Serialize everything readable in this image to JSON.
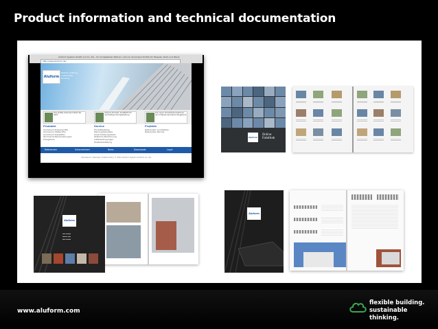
{
  "slide": {
    "title": "Product information and technical documentation"
  },
  "browser": {
    "window_title": "Aluform System GmbH und Co. KG – Ihr kompetenter Partner rund um Aluminium-Profile für Fassade, Dach und Wand",
    "url": "http://www.aluform.de/",
    "site": {
      "logo": "Aluform",
      "slogan": "flexible building. sustainable thinking.",
      "cards": [
        "Das größte Sortiment Stahl der Welt",
        "Aluform-Produkt: ALUMATIC für nachhaltige Dachgestaltung",
        "Die neuen Produktinformationen als umfassendes Nachschlagewerk"
      ],
      "columns": [
        {
          "heading": "Produkte",
          "items": [
            "Aluminium-Trapezprofile",
            "Aluminium-Wellprofile",
            "Aluminium-Kassetten",
            "Technische Beschreibungen",
            "Fotogalerie"
          ]
        },
        {
          "heading": "Service",
          "items": [
            "Produktkatalog",
            "Planungsbeispiele",
            "Ausschreibungstexte",
            "Statische Berechnung",
            "Lieferbedingungen",
            "Musterbestellung"
          ]
        },
        {
          "heading": "Projekte",
          "items": [
            "Referenzen Architekten",
            "Referenzen Partner"
          ]
        }
      ],
      "nav": [
        "Referenzen",
        "Unternehmen",
        "News",
        "Downloads",
        "Login"
      ],
      "footer": "Impressum | Sitemap | Datenschutz | © 2014 Aluform System GmbH & Co. KG"
    }
  },
  "fotothek": {
    "logo": "Aluform",
    "title_line1": "Online",
    "title_line2": "Fotothek"
  },
  "brochure_one": {
    "logo": "Aluform"
  },
  "brochure_two": {
    "logo": "Aluform"
  },
  "footer": {
    "url": "www.aluform.com",
    "tagline_line1": "flexible building.",
    "tagline_line2": "sustainable thinking."
  },
  "colors": {
    "background": "#000000",
    "panel": "#ffffff",
    "site_blue": "#1e5aa8",
    "brand_green": "#3aa853"
  }
}
